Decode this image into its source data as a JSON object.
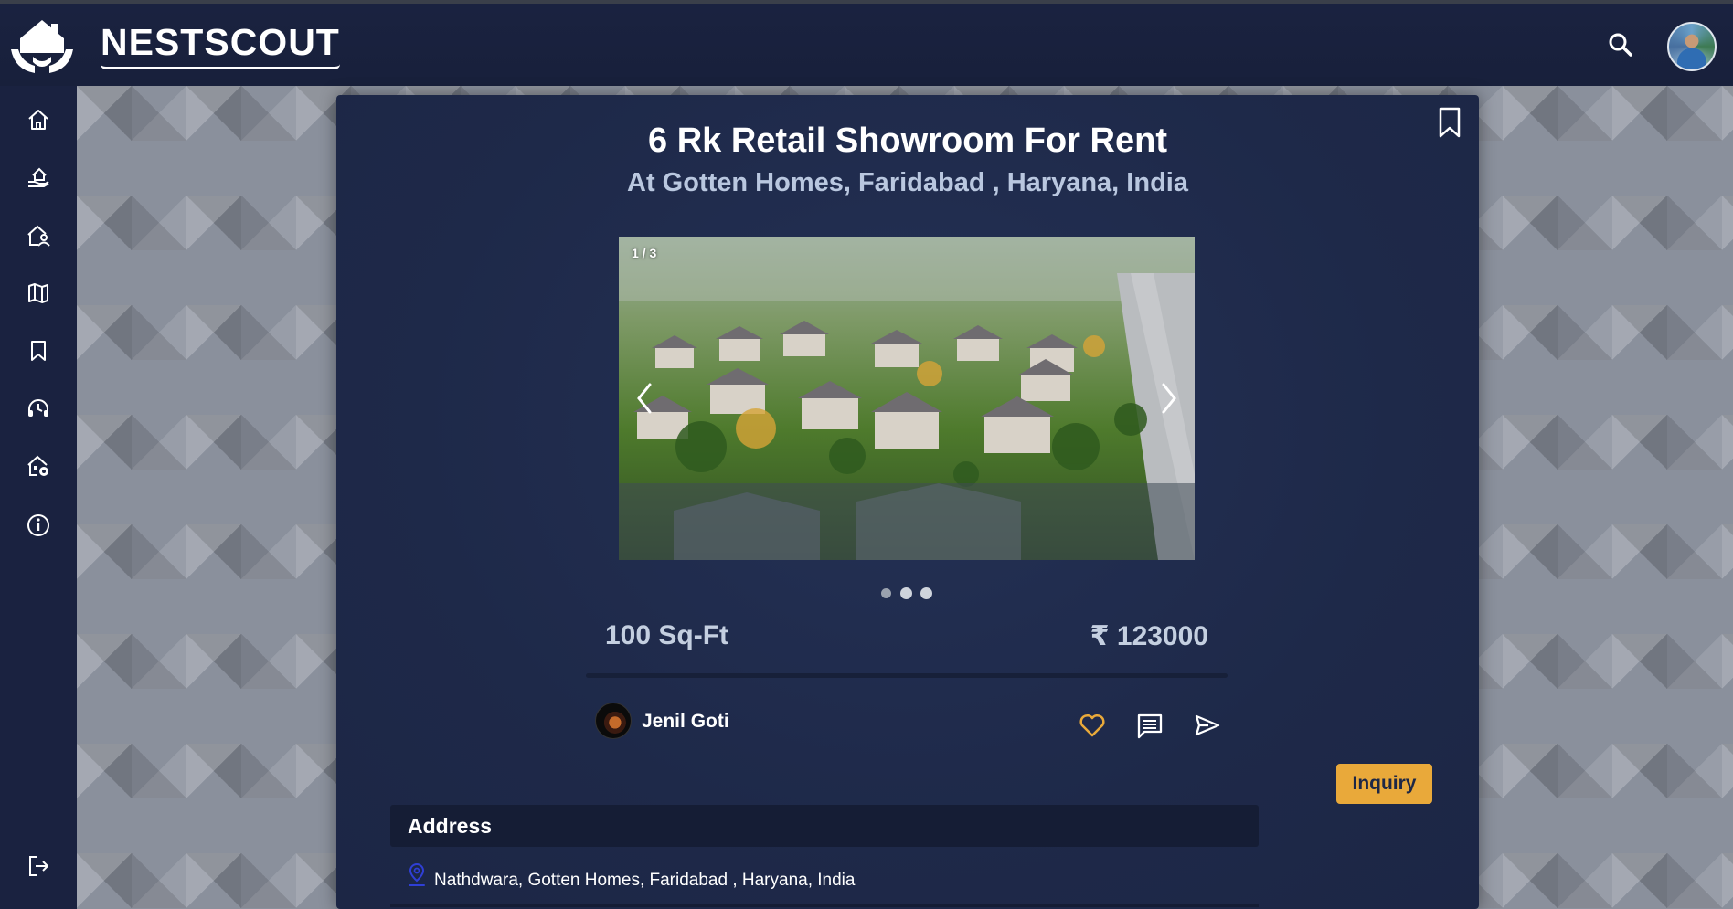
{
  "app": {
    "brand": "NESTSCOUT"
  },
  "header": {
    "search_icon": "search-icon",
    "avatar_icon": "user-avatar"
  },
  "sidebar": {
    "items": [
      {
        "icon": "home-icon"
      },
      {
        "icon": "property-hand-icon"
      },
      {
        "icon": "house-user-icon"
      },
      {
        "icon": "map-icon"
      },
      {
        "icon": "bookmark-icon"
      },
      {
        "icon": "support-headset-icon"
      },
      {
        "icon": "house-settings-icon"
      },
      {
        "icon": "info-icon"
      }
    ],
    "logout_icon": "logout-icon"
  },
  "listing": {
    "title": "6 Rk Retail Showroom For Rent",
    "subtitle": "At Gotten Homes, Faridabad , Haryana, India",
    "image_counter": "1 / 3",
    "image_count": 3,
    "active_image": 1,
    "area": "100 Sq-Ft",
    "price": "₹ 123000",
    "owner_name": "Jenil Goti",
    "inquiry_label": "Inquiry",
    "address_heading": "Address",
    "address_text": "Nathdwara, Gotten Homes, Faridabad , Haryana, India"
  },
  "colors": {
    "accent": "#e9a93a",
    "background": "#1d2746",
    "heart": "#e9a93a",
    "pin": "#2f3fd6"
  }
}
